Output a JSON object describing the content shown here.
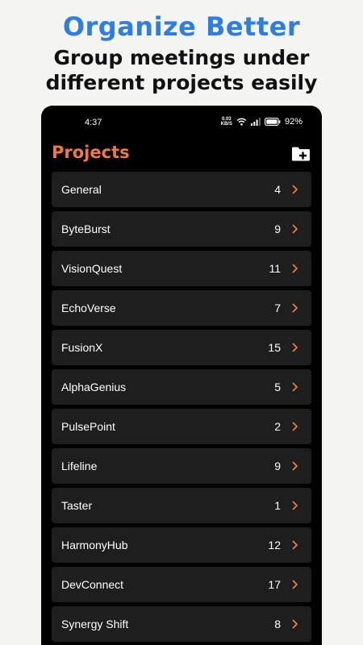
{
  "promo": {
    "headline": "Organize Better",
    "subline_1": "Group meetings under",
    "subline_2": "different projects easily"
  },
  "status_bar": {
    "time": "4:37",
    "net_speed_value": "0.03",
    "net_speed_unit": "KB/S",
    "battery": "92%"
  },
  "header": {
    "title": "Projects",
    "add_icon": "folder-plus-icon"
  },
  "colors": {
    "accent": "#ef7a3f",
    "headline": "#2f7de1",
    "row_background": "#1e1e1e"
  },
  "projects": [
    {
      "name": "General",
      "count": "4"
    },
    {
      "name": "ByteBurst",
      "count": "9"
    },
    {
      "name": "VisionQuest",
      "count": "11"
    },
    {
      "name": "EchoVerse",
      "count": "7"
    },
    {
      "name": "FusionX",
      "count": "15"
    },
    {
      "name": "AlphaGenius",
      "count": "5"
    },
    {
      "name": "PulsePoint",
      "count": "2"
    },
    {
      "name": "Lifeline",
      "count": "9"
    },
    {
      "name": "Taster",
      "count": "1"
    },
    {
      "name": "HarmonyHub",
      "count": "12"
    },
    {
      "name": "DevConnect",
      "count": "17"
    },
    {
      "name": "Synergy Shift",
      "count": "8"
    }
  ]
}
